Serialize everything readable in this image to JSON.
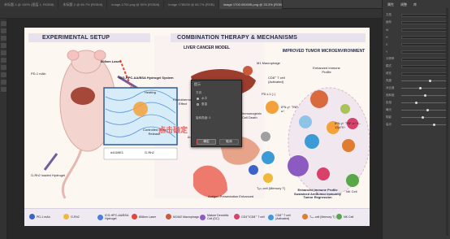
{
  "app": {
    "tabs": [
      "未标题-1 @ 100% (图层 1, RGB/8)",
      "未标题-2 @ 66.7% (RGB/8)",
      "image-1700.png @ 50% (RGB/8)",
      "image 1780/58 @ 66.7% (RGB)",
      "image 1700.000006.png @ 33.3% (RGB/8)"
    ],
    "active_tab": 4
  },
  "panel": {
    "tabs": [
      "属性",
      "调整",
      "库"
    ],
    "rows": [
      {
        "label": "文档",
        "kind": "field"
      },
      {
        "label": "画布",
        "kind": "field"
      },
      {
        "label": "W",
        "kind": "field"
      },
      {
        "label": "H",
        "kind": "field"
      },
      {
        "label": "X",
        "kind": "field"
      },
      {
        "label": "Y",
        "kind": "field"
      },
      {
        "label": "分辨率",
        "kind": "field"
      },
      {
        "label": "模式",
        "kind": "field"
      },
      {
        "label": "填充",
        "kind": "field"
      },
      {
        "label": "亮度",
        "kind": "slider",
        "level": 0.6
      },
      {
        "label": "对比度",
        "kind": "slider",
        "level": 0.4
      },
      {
        "label": "饱和度",
        "kind": "slider",
        "level": 0.5
      },
      {
        "label": "色相",
        "kind": "slider",
        "level": 0.3
      },
      {
        "label": "曝光",
        "kind": "slider",
        "level": 0.55
      },
      {
        "label": "阴影",
        "kind": "slider",
        "level": 0.45
      },
      {
        "label": "高光",
        "kind": "slider",
        "level": 0.7
      }
    ]
  },
  "figure": {
    "left_title": "EXPERIMENTAL SETUP",
    "mid_title": "COMBINATION THERAPY & MECHANISMS",
    "right_title": "IMPROVED TUMOR MICROENVIRONMENT",
    "liver_model": "LIVER CANCER MODEL",
    "pd1_label": "PD-1 mAb",
    "laser_label": "808nm Laser",
    "hydrogel_title": "ICG-HPC-AA/BSA Hydrogel System",
    "heating": "Heating",
    "controlled_release": "Controlled Drug Release",
    "gel_label": "G-Rh2 loaded Hydrogel",
    "icg_code": "#4169E1",
    "grh2": "G-Rh2",
    "photothermal": "Photothermal Effect",
    "synergistic": "Synergistic Antitumor Effect",
    "immunogenic": "Immunogenic Cell Death",
    "macrophage": "M1 Macrophage",
    "cd8_activated": "CD8⁺ T cell (Activated)",
    "pdl1": "PD-L1 (↓)",
    "antigen": "Antigen Presentation Enhanced",
    "tem": "Tₑₘ cell (Memory T)",
    "cytokines_1": "IFN-γ↑ TNF-α↑",
    "cytokines_2": "IFN-γ↑ TNF-α↑ IL-12p70↑",
    "enhanced_profile": "Enhanced Immune Profile",
    "nk": "NK Cell",
    "summary": "Enhanced Immune Profile Sustained Antitumor Immunity Tumor Regression"
  },
  "legend": [
    {
      "label": "PD-1 mAb",
      "color": "#3b63c9"
    },
    {
      "label": "G-Rh2",
      "color": "#f1b93b"
    },
    {
      "label": "ICG-HPC-AA/BSA Hydrogel",
      "color": "#4c7fd6"
    },
    {
      "label": "808nm Laser",
      "color": "#e2463f"
    },
    {
      "label": "M1/M2 Macrophage",
      "color": "#c95b3c"
    },
    {
      "label": "Mature Dendritic Cell (DC)",
      "color": "#8c5bc2"
    },
    {
      "label": "CD4⁺/CD8⁺ T cell",
      "color": "#d8426a"
    },
    {
      "label": "CD8⁺ T cell (Activated)",
      "color": "#3a9bd6"
    },
    {
      "label": "Tₑₘ cell (Memory T)",
      "color": "#e07c2f"
    },
    {
      "label": "NK Cell",
      "color": "#58a84a"
    }
  ],
  "dialog": {
    "title": "提示",
    "group_label": "方向",
    "option_a": "水平",
    "option_b": "垂直",
    "sub_label": "旋转角度: 0",
    "ok": "确定",
    "cancel": "取消"
  },
  "hint_text": "点击确定"
}
